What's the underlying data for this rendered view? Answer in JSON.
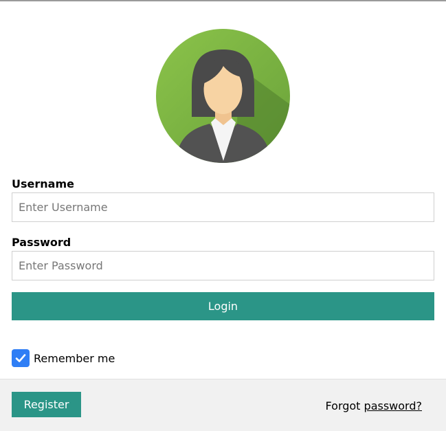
{
  "avatar": {
    "icon": "female-user-avatar-icon",
    "accent": "#8bc34a"
  },
  "form": {
    "username_label": "Username",
    "username_placeholder": "Enter Username",
    "username_value": "",
    "password_label": "Password",
    "password_placeholder": "Enter Password",
    "password_value": "",
    "login_label": "Login",
    "remember_label": "Remember me",
    "remember_checked": true
  },
  "footer": {
    "register_label": "Register",
    "forgot_prefix": "Forgot",
    "forgot_link": "password?"
  },
  "colors": {
    "primary": "#2b9587",
    "checkbox": "#2f7ef5",
    "footer_bg": "#f1f1f1"
  }
}
